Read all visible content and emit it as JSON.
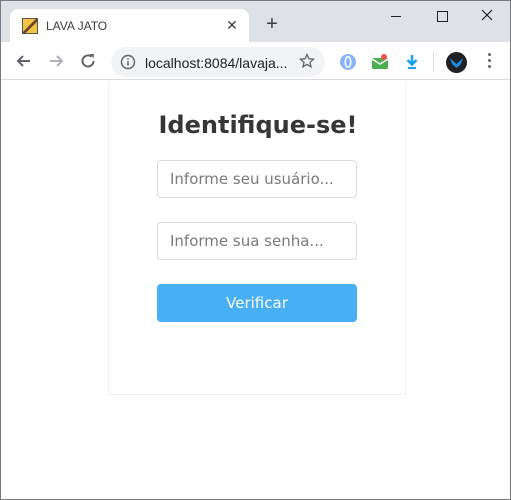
{
  "browser": {
    "tab": {
      "title": "LAVA JATO",
      "close_glyph": "✕"
    },
    "new_tab_glyph": "+",
    "address_bar": {
      "url": "localhost:8084/lavaja..."
    },
    "icons": {
      "back": "arrow-left-icon",
      "forward": "arrow-right-icon",
      "reload": "reload-icon",
      "info": "info-icon",
      "bookmark": "star-icon",
      "extension_1": "opera-extension-icon",
      "extension_2": "mail-extension-icon",
      "extension_3": "download-extension-icon",
      "profile": "avatar-icon",
      "menu": "kebab-menu-icon"
    }
  },
  "login": {
    "heading": "Identifique-se!",
    "user_placeholder": "Informe seu usuário...",
    "password_placeholder": "Informe sua senha...",
    "submit_label": "Verificar"
  },
  "colors": {
    "button": "#48aff4",
    "heading": "#363636",
    "tab_strip": "#dee1e6"
  }
}
